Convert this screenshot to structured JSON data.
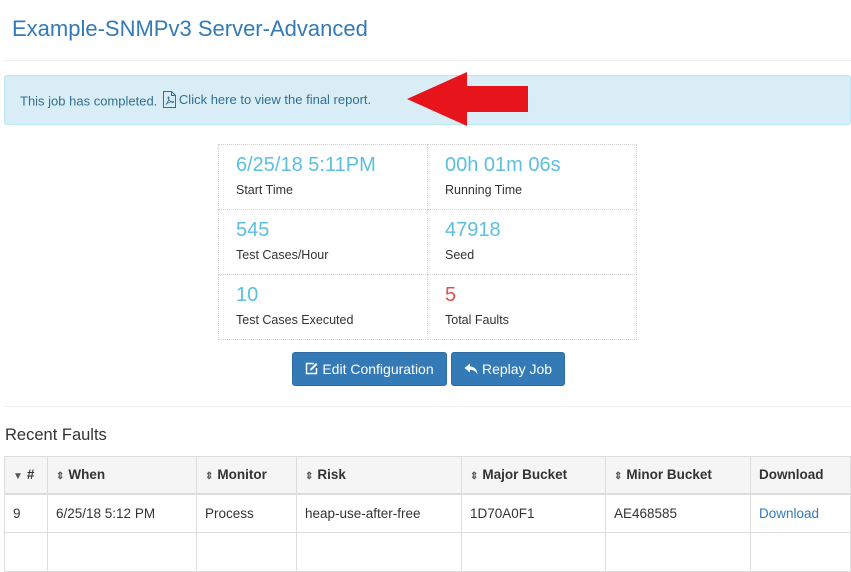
{
  "title": "Example-SNMPv3 Server-Advanced",
  "alert": {
    "message": "This job has completed.",
    "link_text": "Click here to view the final report."
  },
  "stats": [
    {
      "value": "6/25/18 5:11PM",
      "label": "Start Time"
    },
    {
      "value": "00h 01m 06s",
      "label": "Running Time"
    },
    {
      "value": "545",
      "label": "Test Cases/Hour"
    },
    {
      "value": "47918",
      "label": "Seed"
    },
    {
      "value": "10",
      "label": "Test Cases Executed"
    },
    {
      "value": "5",
      "label": "Total Faults"
    }
  ],
  "buttons": {
    "edit": "Edit Configuration",
    "replay": "Replay Job"
  },
  "recent_faults": {
    "title": "Recent Faults",
    "columns": [
      "#",
      "When",
      "Monitor",
      "Risk",
      "Major Bucket",
      "Minor Bucket",
      "Download"
    ],
    "rows": [
      [
        "9",
        "6/25/18 5:12 PM",
        "Process",
        "heap-use-after-free",
        "1D70A0F1",
        "AE468585",
        "Download"
      ]
    ]
  },
  "icons": {
    "pdf": "file-pdf-icon",
    "edit": "edit-icon",
    "replay": "reply-icon",
    "sort_desc": "sort-desc-icon",
    "sort": "sort-icon",
    "annotation": "red-arrow-annotation"
  },
  "colors": {
    "primary": "#337ab7",
    "info": "#5bc0de",
    "danger": "#d9534f",
    "alert_bg": "#d9edf7"
  }
}
